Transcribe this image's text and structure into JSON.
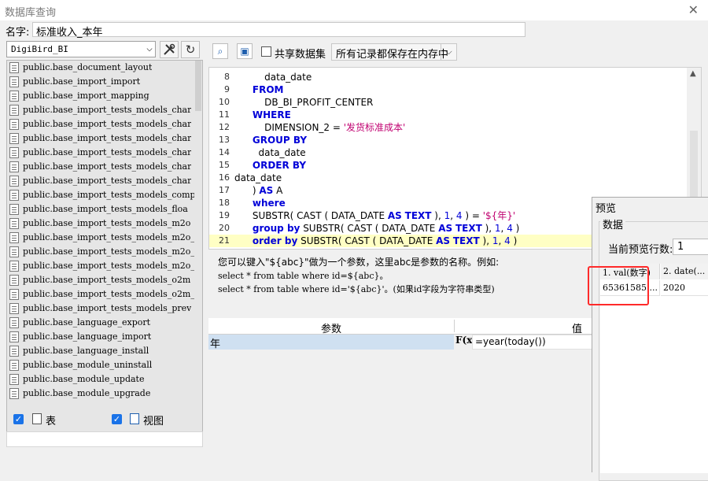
{
  "window": {
    "title": "数据库查询",
    "close_glyph": "✕"
  },
  "name": {
    "label": "名字:",
    "value": "标准收入_本年"
  },
  "left": {
    "db_selected": "DigiBird_BI",
    "tables": [
      "public.base_document_layout",
      "public.base_import_import",
      "public.base_import_mapping",
      "public.base_import_tests_models_char",
      "public.base_import_tests_models_char",
      "public.base_import_tests_models_char",
      "public.base_import_tests_models_char",
      "public.base_import_tests_models_char",
      "public.base_import_tests_models_char",
      "public.base_import_tests_models_comp",
      "public.base_import_tests_models_floa",
      "public.base_import_tests_models_m2o",
      "public.base_import_tests_models_m2o_",
      "public.base_import_tests_models_m2o_",
      "public.base_import_tests_models_m2o_",
      "public.base_import_tests_models_o2m",
      "public.base_import_tests_models_o2m_",
      "public.base_import_tests_models_prev",
      "public.base_language_export",
      "public.base_language_import",
      "public.base_language_install",
      "public.base_module_uninstall",
      "public.base_module_update",
      "public.base_module_upgrade"
    ],
    "check_table_label": "表",
    "check_view_label": "视图"
  },
  "toolbar": {
    "share_label": "共享数据集",
    "storage_option": "所有记录都保存在内存中"
  },
  "editor": {
    "lines": [
      {
        "n": "8",
        "code": "          data_date"
      },
      {
        "n": "9",
        "code": "      FROM"
      },
      {
        "n": "10",
        "code": "          DB_BI_PROFIT_CENTER"
      },
      {
        "n": "11",
        "code": "      WHERE"
      },
      {
        "n": "12",
        "code": "          DIMENSION_2 = '发货标准成本'"
      },
      {
        "n": "13",
        "code": "      GROUP BY"
      },
      {
        "n": "14",
        "code": "        data_date"
      },
      {
        "n": "15",
        "code": "      ORDER BY"
      },
      {
        "n": "16",
        "code": "data_date"
      },
      {
        "n": "17",
        "code": "      ) AS A"
      },
      {
        "n": "18",
        "code": "      where"
      },
      {
        "n": "19",
        "code": "      SUBSTR( CAST ( DATA_DATE AS TEXT ), 1, 4 ) = '${年}'"
      },
      {
        "n": "20",
        "code": "      group by SUBSTR( CAST ( DATA_DATE AS TEXT ), 1, 4 )"
      },
      {
        "n": "21",
        "code": "      order by SUBSTR( CAST ( DATA_DATE AS TEXT ), 1, 4 )"
      }
    ],
    "current_line": "21"
  },
  "hint": {
    "line1": "您可以键入\"${abc}\"做为一个参数，这里abc是参数的名称。例如:",
    "line2": "select * from table where id=${abc}。",
    "line3": "select * from table where id='${abc}'。(如果id字段为字符串类型)"
  },
  "params": {
    "col_name": "参数",
    "col_value": "值",
    "rows": [
      {
        "name": "年",
        "fx": "F(x)",
        "value": "=year(today())"
      }
    ]
  },
  "preview": {
    "title": "预览",
    "group_label": "数据",
    "rows_label": "当前预览行数:",
    "rows_value": "1",
    "columns": [
      "1. val(数字)",
      "2. date(..."
    ],
    "cells": [
      "65361585....",
      "2020"
    ]
  },
  "colors": {
    "keyword": "#0000d8",
    "string": "#c00070",
    "current_line": "#ffffc4",
    "highlight_box": "#ff2a2a"
  }
}
